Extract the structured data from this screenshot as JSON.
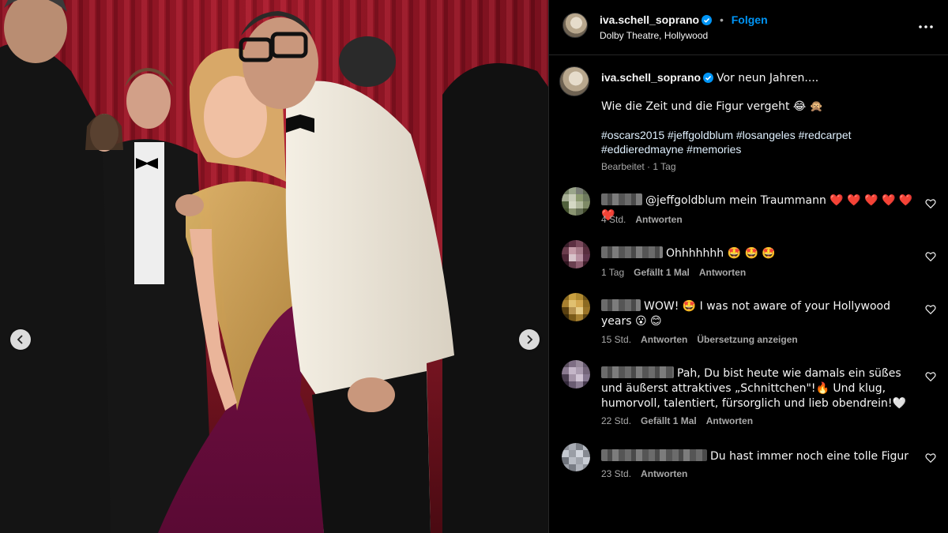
{
  "post": {
    "username": "iva.schell_soprano",
    "follow_label": "Folgen",
    "separator": "•",
    "location": "Dolby Theatre, Hollywood",
    "more_icon": "more-horizontal-icon"
  },
  "caption": {
    "username": "iva.schell_soprano",
    "line1": "Vor neun Jahren....",
    "line2": "Wie die Zeit und die Figur vergeht 😂 🙊",
    "hashtags_line1": "#oscars2015 #jeffgoldblum #losangeles #redcarpet",
    "hashtags_line2": "#eddieredmayne #memories",
    "edited": "Bearbeitet",
    "time": "1 Tag"
  },
  "comments": [
    {
      "text": "@jeffgoldblum mein Traummann ❤️ ❤️ ❤️ ❤️ ❤️ ❤️",
      "time": "4 Std.",
      "likes": "",
      "reply": "Antworten",
      "extra": ""
    },
    {
      "text": "Ohhhhhhh 🤩 🤩 🤩",
      "time": "1 Tag",
      "likes": "Gefällt 1 Mal",
      "reply": "Antworten",
      "extra": ""
    },
    {
      "text": "WOW! 🤩 I was not aware of your Hollywood years 😮 😊",
      "time": "15 Std.",
      "likes": "",
      "reply": "Antworten",
      "extra": "Übersetzung anzeigen"
    },
    {
      "text": "Pah, Du bist heute wie damals ein süßes und äußerst attraktives „Schnittchen\"!🔥 Und klug, humorvoll, talentiert, fürsorglich und lieb obendrein!🤍",
      "time": "22 Std.",
      "likes": "Gefällt 1 Mal",
      "reply": "Antworten",
      "extra": ""
    },
    {
      "text": "Du hast immer noch eine tolle Figur",
      "time": "23 Std.",
      "likes": "",
      "reply": "Antworten",
      "extra": ""
    }
  ],
  "colors": {
    "background": "#000000",
    "link": "#0095f6",
    "verified": "#0095f6",
    "secondary_text": "#a8a8a8",
    "divider": "#262626"
  },
  "icons": {
    "prev": "chevron-left-icon",
    "next": "chevron-right-icon",
    "like": "heart-outline-icon",
    "verified": "verified-badge-icon"
  }
}
